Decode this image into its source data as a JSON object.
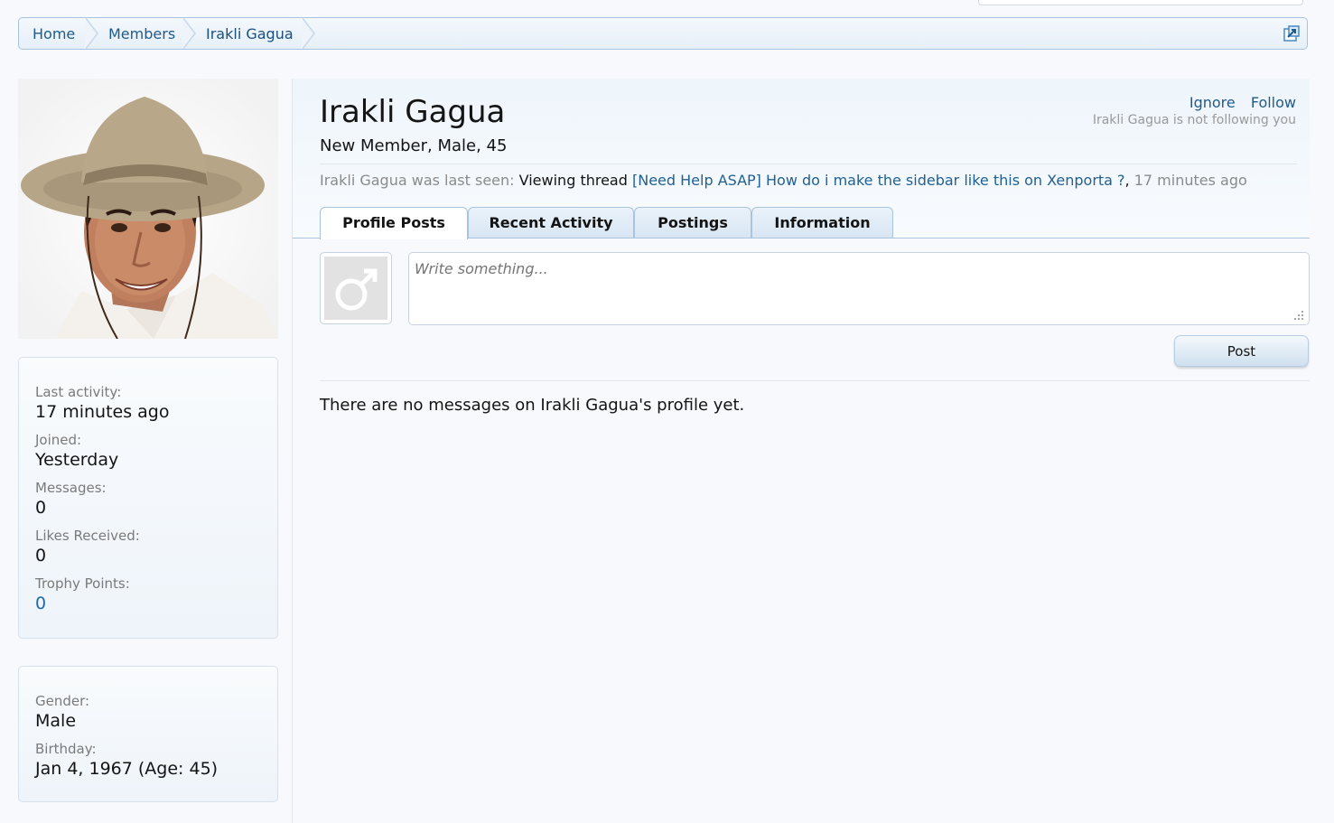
{
  "breadcrumb": {
    "items": [
      "Home",
      "Members",
      "Irakli Gagua"
    ]
  },
  "profile": {
    "name": "Irakli Gagua",
    "blurb": "New Member, Male, 45",
    "actions": {
      "ignore": "Ignore",
      "follow": "Follow"
    },
    "follow_status": "Irakli Gagua is not following you",
    "last_seen": {
      "prefix": "Irakli Gagua was last seen:",
      "activity": "Viewing thread",
      "thread_title": "[Need Help ASAP] How do i make the sidebar like this on Xenporta ?",
      "time": "17 minutes ago"
    }
  },
  "tabs": [
    "Profile Posts",
    "Recent Activity",
    "Postings",
    "Information"
  ],
  "post_form": {
    "placeholder": "Write something...",
    "button": "Post"
  },
  "empty_message": "There are no messages on Irakli Gagua's profile yet.",
  "stats": {
    "last_activity_label": "Last activity:",
    "last_activity_value": "17 minutes ago",
    "joined_label": "Joined:",
    "joined_value": "Yesterday",
    "messages_label": "Messages:",
    "messages_value": "0",
    "likes_label": "Likes Received:",
    "likes_value": "0",
    "trophy_label": "Trophy Points:",
    "trophy_value": "0"
  },
  "info": {
    "gender_label": "Gender:",
    "gender_value": "Male",
    "birthday_label": "Birthday:",
    "birthday_value": "Jan 4, 1967 (Age: 45)"
  },
  "colors": {
    "link": "#1e5b8c",
    "muted": "#8a8a8a",
    "border": "#a8c4de"
  },
  "icons": [
    "jump-menu-icon",
    "male-symbol-icon",
    "resize-grip-icon"
  ]
}
